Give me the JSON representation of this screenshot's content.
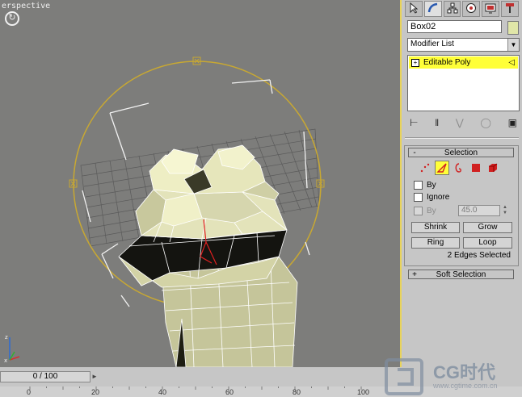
{
  "viewport": {
    "label": "erspective",
    "nav_icon": "rotate-icon"
  },
  "command_panel": {
    "tabs": [
      {
        "name": "create-tab",
        "icon": "cursor-arrow-icon"
      },
      {
        "name": "modify-tab",
        "icon": "modify-curve-icon"
      },
      {
        "name": "hierarchy-tab",
        "icon": "hierarchy-icon"
      },
      {
        "name": "motion-tab",
        "icon": "motion-icon"
      },
      {
        "name": "display-tab",
        "icon": "display-icon"
      },
      {
        "name": "utilities-tab",
        "icon": "hammer-icon"
      }
    ],
    "object_name": "Box02",
    "object_color": "#e0e6a8",
    "modifier_list": "Modifier List",
    "stack_item": "Editable Poly",
    "stack_highlight_color": "#ffff38"
  },
  "selection": {
    "title": "Selection",
    "collapse_sign": "-",
    "by_label": "By",
    "ignore_label": "Ignore",
    "by_angle_label": "By",
    "angle_value": "45.0",
    "shrink": "Shrink",
    "grow": "Grow",
    "ring": "Ring",
    "loop": "Loop",
    "status": "2 Edges Selected"
  },
  "soft_selection": {
    "title": "Soft Selection",
    "expand_sign": "+"
  },
  "timeline": {
    "frame": "0 / 100",
    "ticks": [
      "0",
      "20",
      "40",
      "60",
      "80",
      "100"
    ]
  },
  "watermark": {
    "text": "CG时代",
    "url": "www.cgtime.com.cn"
  }
}
